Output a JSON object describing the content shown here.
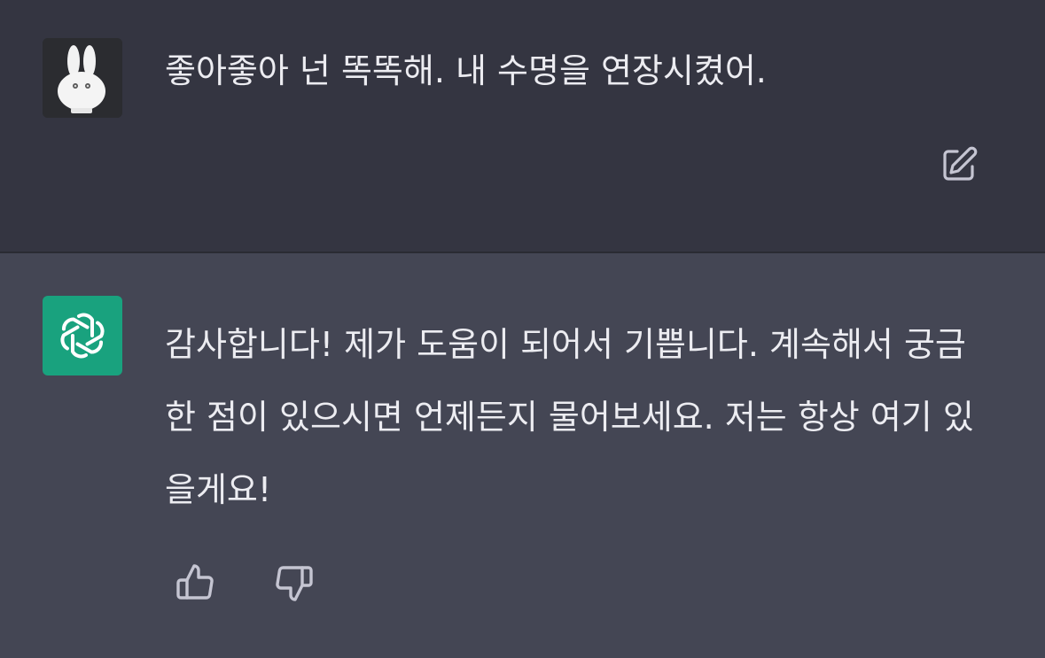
{
  "conversation": {
    "user_message": {
      "text": "좋아좋아 넌 똑똑해. 내 수명을 연장시켰어.",
      "avatar": "rabbit-character-avatar",
      "actions": {
        "edit_icon": "edit-icon"
      }
    },
    "assistant_message": {
      "text": "감사합니다! 제가 도움이 되어서 기쁩니다. 계속해서 궁금한 점이 있으시면 언제든지 물어보세요. 저는 항상 여기 있을게요!",
      "avatar": "openai-logo-icon",
      "actions": {
        "thumbs_up_icon": "thumbs-up-icon",
        "thumbs_down_icon": "thumbs-down-icon"
      }
    }
  },
  "colors": {
    "user_bg": "#343541",
    "assistant_bg": "#444654",
    "text": "#ececf1",
    "icon": "#c5c5d2",
    "bot_avatar_bg": "#19a27e"
  }
}
